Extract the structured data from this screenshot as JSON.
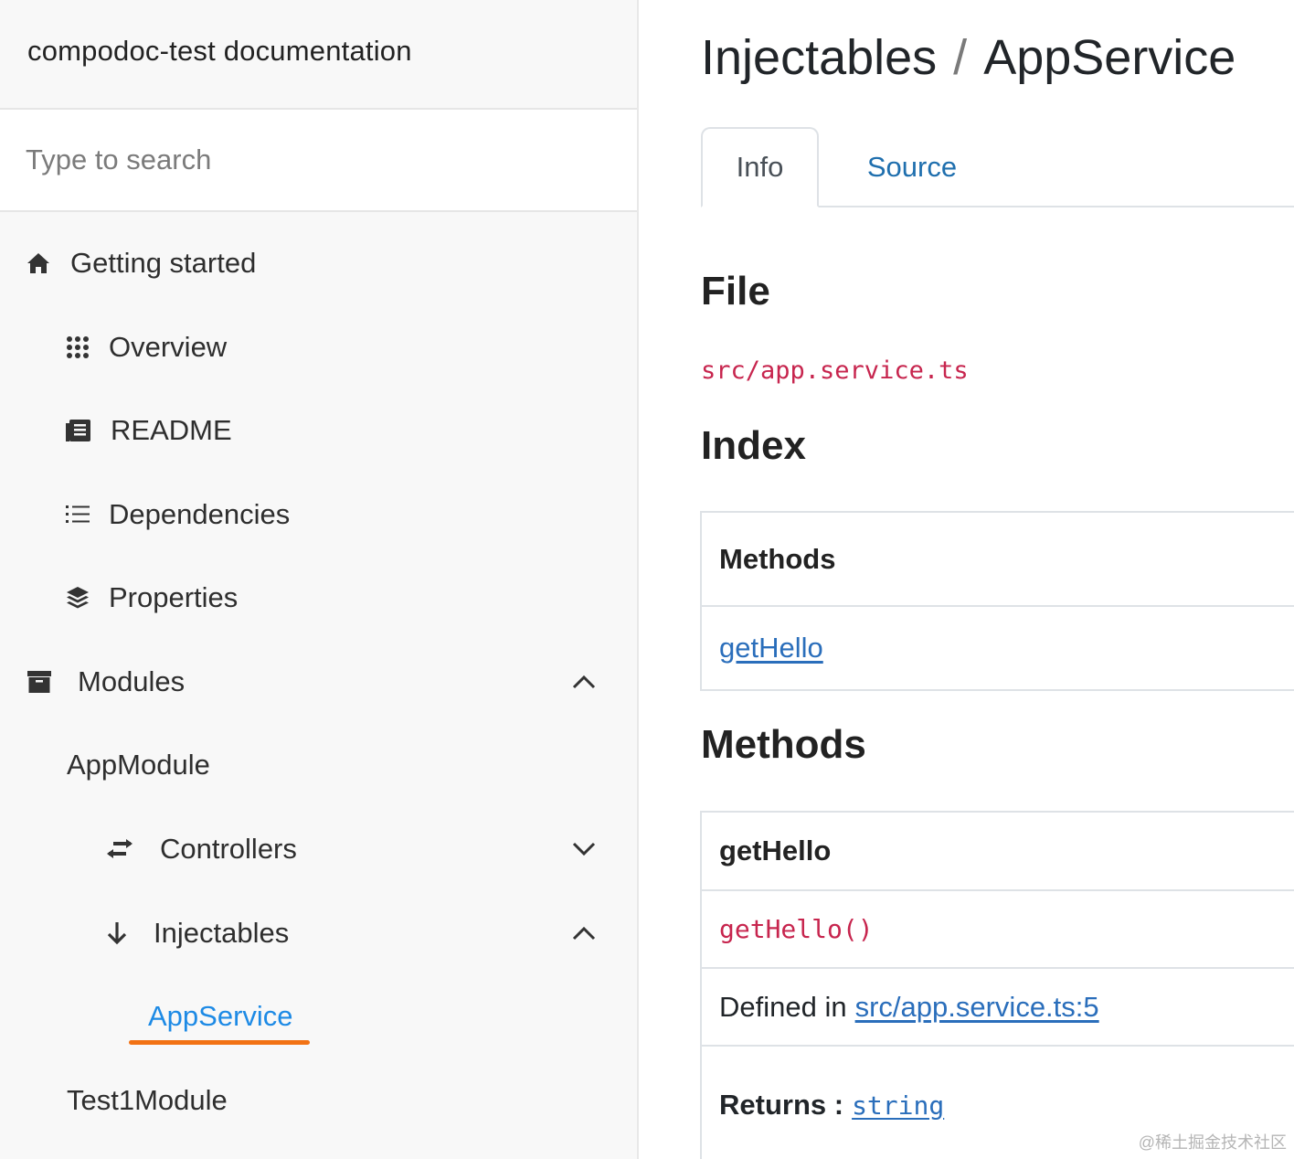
{
  "sidebar": {
    "title": "compodoc-test documentation",
    "search_placeholder": "Type to search",
    "items": {
      "getting_started": "Getting started",
      "overview": "Overview",
      "readme": "README",
      "dependencies": "Dependencies",
      "properties": "Properties",
      "modules": "Modules",
      "app_module": "AppModule",
      "controllers": "Controllers",
      "injectables": "Injectables",
      "app_service": "AppService",
      "test1_module": "Test1Module"
    }
  },
  "main": {
    "breadcrumb": {
      "parent": "Injectables",
      "separator": "/",
      "current": "AppService"
    },
    "tabs": {
      "info": "Info",
      "source": "Source"
    },
    "file_heading": "File",
    "file_path": "src/app.service.ts",
    "index_heading": "Index",
    "index_table": {
      "header": "Methods",
      "link": "getHello"
    },
    "methods_heading": "Methods",
    "method_table": {
      "name": "getHello",
      "signature": "getHello()",
      "defined_in_label": "Defined in",
      "defined_in_link": "src/app.service.ts:5",
      "returns_label": "Returns :",
      "returns_type": "string"
    }
  },
  "watermark": "@稀土掘金技术社区",
  "colors": {
    "active_link": "#1d8ae5",
    "underline_mark": "#f27214",
    "code": "#c7254e",
    "link": "#2a6ebb"
  }
}
